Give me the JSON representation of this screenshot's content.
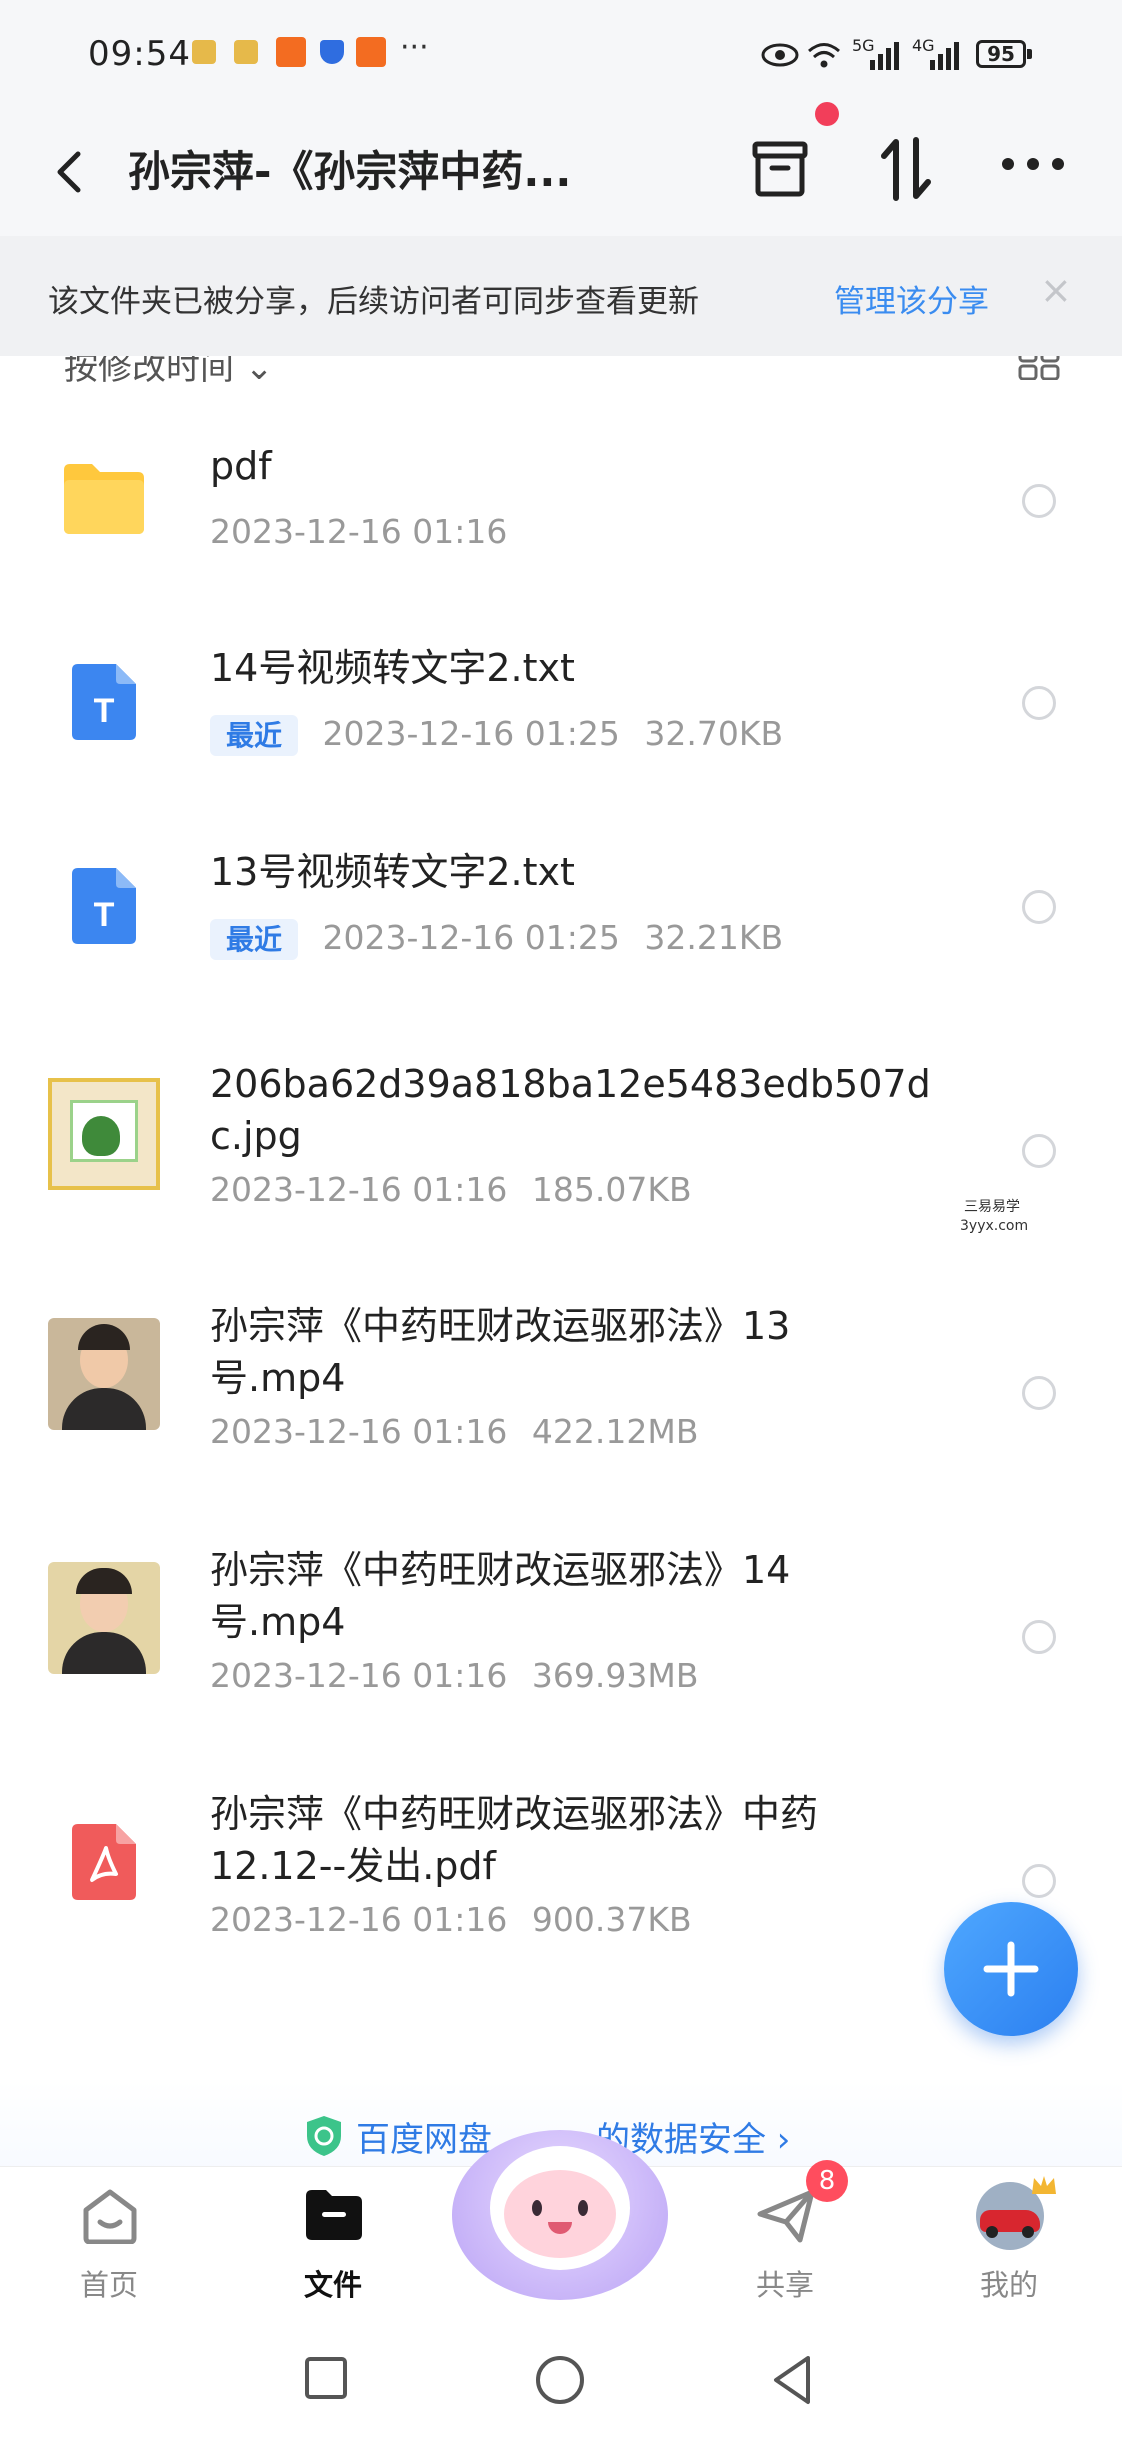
{
  "status_bar": {
    "time": "09:54",
    "more": "···",
    "net1": "5G",
    "net2": "4G",
    "battery": "95"
  },
  "header": {
    "title": "孙宗萍-《孙宗萍中药..."
  },
  "share_banner": {
    "text": "该文件夹已被分享，后续访问者可同步查看更新",
    "link": "管理该分享",
    "close": "×"
  },
  "sort": {
    "label": "按修改时间"
  },
  "files": [
    {
      "name": "pdf",
      "date": "2023-12-16  01:16",
      "size": "",
      "recent": "",
      "icon": "folder-icon"
    },
    {
      "name": "14号视频转文字2.txt",
      "date": "2023-12-16  01:25",
      "size": "32.70KB",
      "recent": "最近",
      "icon": "txt-file-icon"
    },
    {
      "name": "13号视频转文字2.txt",
      "date": "2023-12-16  01:25",
      "size": "32.21KB",
      "recent": "最近",
      "icon": "txt-file-icon"
    },
    {
      "name": "206ba62d39a818ba12e5483edb507dc.jpg",
      "date": "2023-12-16  01:16",
      "size": "185.07KB",
      "recent": "",
      "icon": "image-thumbnail"
    },
    {
      "name": "孙宗萍《中药旺财改运驱邪法》13号.mp4",
      "date": "2023-12-16  01:16",
      "size": "422.12MB",
      "recent": "",
      "icon": "video-thumbnail"
    },
    {
      "name": "孙宗萍《中药旺财改运驱邪法》14号.mp4",
      "date": "2023-12-16  01:16",
      "size": "369.93MB",
      "recent": "",
      "icon": "video-thumbnail"
    },
    {
      "name": "孙宗萍《中药旺财改运驱邪法》中药12.12--发出.pdf",
      "date": "2023-12-16  01:16",
      "size": "900.37KB",
      "recent": "",
      "icon": "pdf-file-icon"
    }
  ],
  "watermark": {
    "line1": "三易易学",
    "line2": "3yyx.com"
  },
  "security": {
    "text": "百度网盘",
    "text2": "的数据安全 ›"
  },
  "bottom_nav": {
    "items": [
      {
        "label": "首页",
        "icon": "home-icon"
      },
      {
        "label": "文件",
        "icon": "folder-icon"
      },
      {
        "label": "",
        "icon": "mascot-icon"
      },
      {
        "label": "共享",
        "icon": "share-icon"
      },
      {
        "label": "我的",
        "icon": "avatar"
      }
    ],
    "badge": "8"
  },
  "colors": {
    "accent": "#2f7be5",
    "fab": "#3a8cf0",
    "pdf": "#f05b5b",
    "txt": "#3c86f0",
    "folder": "#ffc83d"
  }
}
